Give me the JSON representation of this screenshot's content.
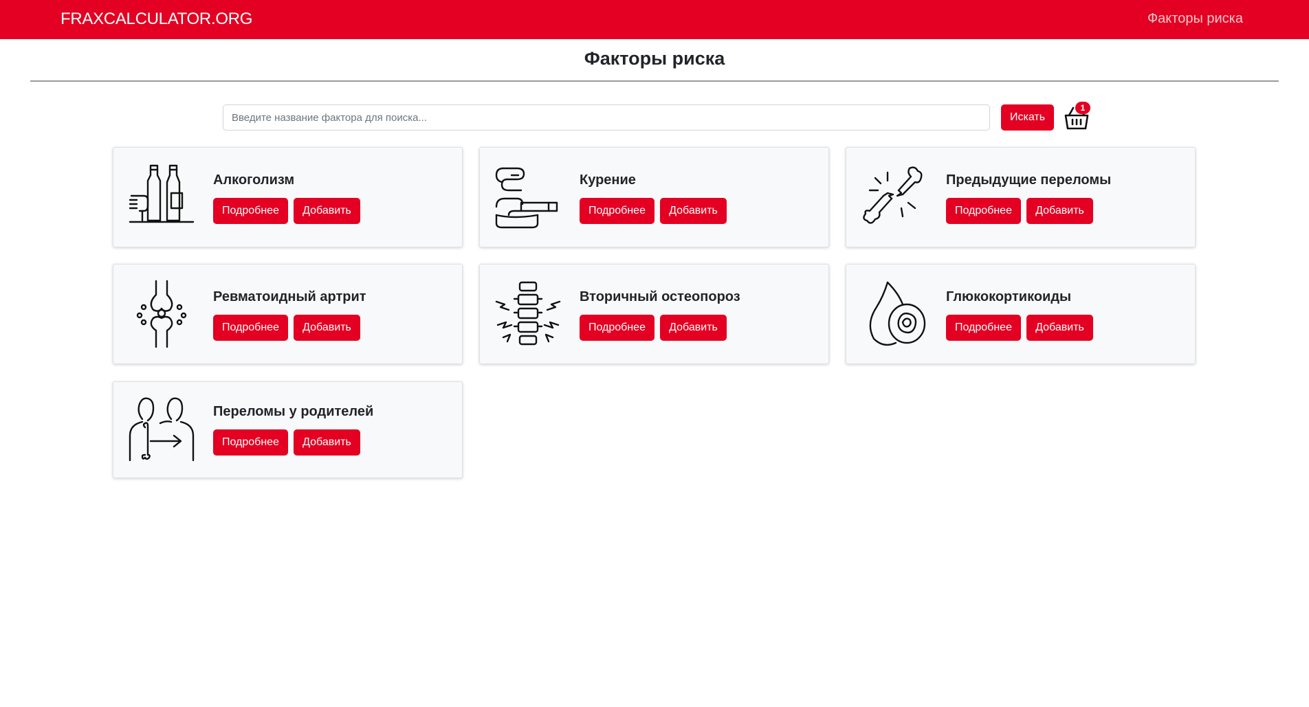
{
  "navbar": {
    "brand": "FRAXCALCULATOR.ORG",
    "link": "Факторы риска",
    "color": "#e30022"
  },
  "page": {
    "title": "Факторы риска"
  },
  "search": {
    "placeholder": "Введите название фактора для поиска...",
    "value": "",
    "button": "Искать"
  },
  "cart": {
    "icon": "basket-icon",
    "count": "1"
  },
  "factors": [
    {
      "title": "Алкоголизм",
      "icon": "alcohol-bottles-icon",
      "more": "Подробнее",
      "add": "Добавить"
    },
    {
      "title": "Курение",
      "icon": "smoking-cigarette-icon",
      "more": "Подробнее",
      "add": "Добавить"
    },
    {
      "title": "Предыдущие переломы",
      "icon": "broken-bone-icon",
      "more": "Подробнее",
      "add": "Добавить"
    },
    {
      "title": "Ревматоидный артрит",
      "icon": "knee-joint-icon",
      "more": "Подробнее",
      "add": "Добавить"
    },
    {
      "title": "Вторичный остеопороз",
      "icon": "spine-fracture-icon",
      "more": "Подробнее",
      "add": "Добавить"
    },
    {
      "title": "Глюкокортикоиды",
      "icon": "adrenal-gland-icon",
      "more": "Подробнее",
      "add": "Добавить"
    },
    {
      "title": "Переломы у родителей",
      "icon": "parents-bone-icon",
      "more": "Подробнее",
      "add": "Добавить"
    }
  ]
}
